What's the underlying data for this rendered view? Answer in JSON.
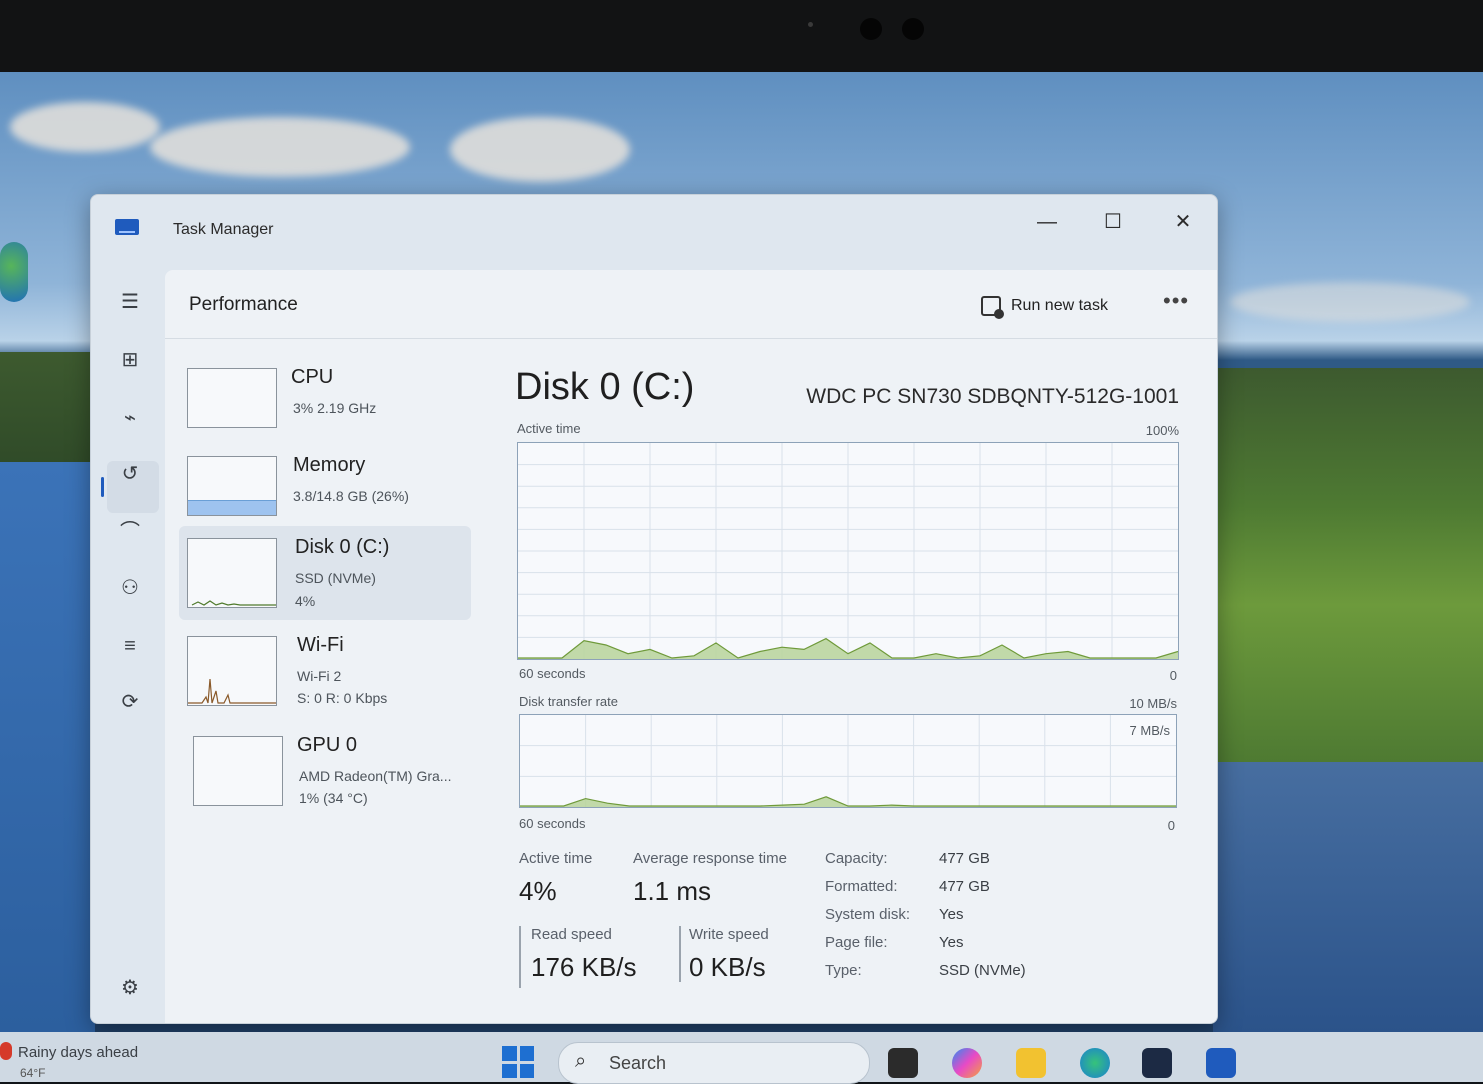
{
  "window": {
    "title": "Task Manager",
    "controls": {
      "minimize": "—",
      "maximize": "☐",
      "close": "✕"
    }
  },
  "header": {
    "page_title": "Performance",
    "run_new_task": "Run new task",
    "more": "•••"
  },
  "sidebar": {
    "icons": [
      "menu-icon",
      "processes-icon",
      "performance-icon",
      "app-history-icon",
      "startup-icon",
      "users-icon",
      "details-icon",
      "services-icon",
      "settings-icon"
    ]
  },
  "devices": [
    {
      "name": "CPU",
      "line1": "3% 2.19 GHz",
      "line2": ""
    },
    {
      "name": "Memory",
      "line1": "3.8/14.8 GB (26%)",
      "line2": "",
      "fill_percent": 26
    },
    {
      "name": "Disk 0 (C:)",
      "line1": "SSD (NVMe)",
      "line2": "4%"
    },
    {
      "name": "Wi-Fi",
      "line1": "Wi-Fi 2",
      "line2": "S: 0 R: 0 Kbps"
    },
    {
      "name": "GPU 0",
      "line1": "AMD Radeon(TM) Gra...",
      "line2": "1% (34 °C)"
    }
  ],
  "detail": {
    "title": "Disk 0 (C:)",
    "model": "WDC PC SN730 SDBQNTY-512G-1001",
    "chart1": {
      "label": "Active time",
      "max": "100%",
      "time": "60 seconds",
      "zero": "0"
    },
    "chart2": {
      "label": "Disk transfer rate",
      "max": "10 MB/s",
      "mid": "7 MB/s",
      "time": "60 seconds",
      "zero": "0"
    },
    "stats": {
      "active_time_label": "Active time",
      "active_time_value": "4%",
      "avg_response_label": "Average response time",
      "avg_response_value": "1.1 ms",
      "read_speed_label": "Read speed",
      "read_speed_value": "176 KB/s",
      "write_speed_label": "Write speed",
      "write_speed_value": "0 KB/s"
    },
    "properties": [
      {
        "key": "Capacity:",
        "value": "477 GB"
      },
      {
        "key": "Formatted:",
        "value": "477 GB"
      },
      {
        "key": "System disk:",
        "value": "Yes"
      },
      {
        "key": "Page file:",
        "value": "Yes"
      },
      {
        "key": "Type:",
        "value": "SSD (NVMe)"
      }
    ]
  },
  "taskbar": {
    "weather_text": "Rainy days ahead",
    "weather_temp": "64°F",
    "search_placeholder": "Search"
  },
  "chart_data": [
    {
      "type": "area",
      "title": "Active time",
      "ylim": [
        0,
        100
      ],
      "x": [
        0,
        2,
        4,
        6,
        8,
        10,
        12,
        14,
        16,
        18,
        20,
        22,
        24,
        26,
        28,
        30,
        32,
        34,
        36,
        38,
        40,
        42,
        44,
        46,
        48,
        50,
        52,
        54,
        56,
        58,
        60
      ],
      "values": [
        0,
        0,
        0,
        8,
        6,
        2,
        4,
        0,
        1,
        7,
        0,
        3,
        5,
        4,
        9,
        2,
        7,
        0,
        0,
        2,
        0,
        1,
        6,
        0,
        2,
        3,
        0,
        0,
        0,
        0,
        3
      ]
    },
    {
      "type": "area",
      "title": "Disk transfer rate",
      "ylim": [
        0,
        10
      ],
      "x": [
        0,
        2,
        4,
        6,
        8,
        10,
        12,
        14,
        16,
        18,
        20,
        22,
        24,
        26,
        28,
        30,
        32,
        34,
        36,
        38,
        40,
        42,
        44,
        46,
        48,
        50,
        52,
        54,
        56,
        58,
        60
      ],
      "values": [
        0,
        0,
        0,
        0.8,
        0.3,
        0,
        0,
        0,
        0,
        0,
        0,
        0,
        0.1,
        0.2,
        1.0,
        0,
        0,
        0.1,
        0,
        0,
        0,
        0,
        0,
        0,
        0,
        0,
        0,
        0,
        0,
        0,
        0
      ]
    }
  ]
}
